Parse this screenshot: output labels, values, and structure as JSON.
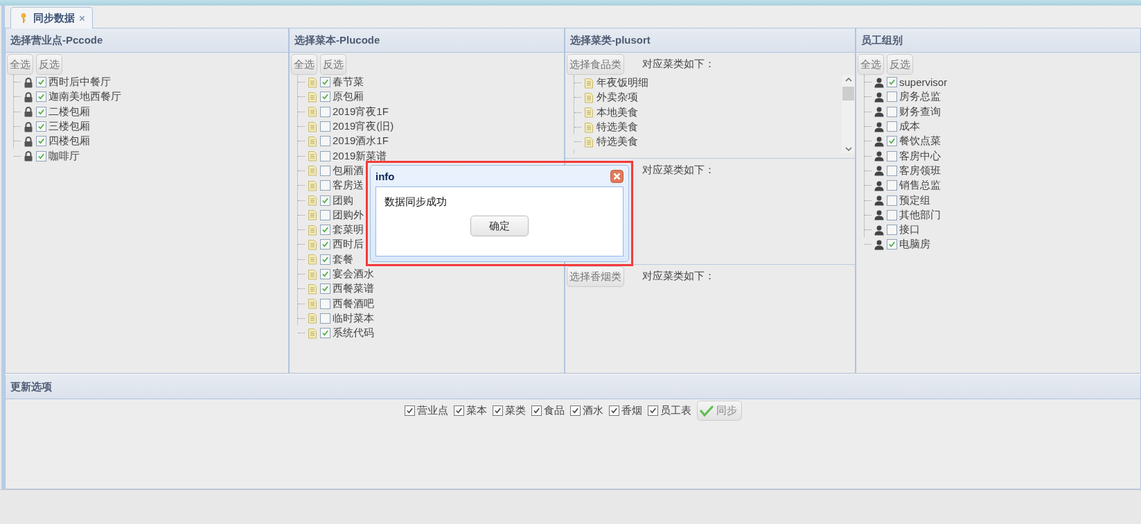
{
  "tab": {
    "label": "同步数据",
    "selected": true
  },
  "panels": [
    {
      "kind": "outlets",
      "title": "选择营业点-Pccode",
      "buttons": [
        "全选",
        "反选"
      ],
      "items": [
        {
          "label": "西时后中餐厅",
          "checked": true
        },
        {
          "label": "迦南美地西餐厅",
          "checked": true
        },
        {
          "label": "二楼包厢",
          "checked": true
        },
        {
          "label": "三楼包厢",
          "checked": true
        },
        {
          "label": "四楼包厢",
          "checked": true
        },
        {
          "label": "咖啡厅",
          "checked": true
        }
      ]
    },
    {
      "kind": "menus",
      "title": "选择菜本-Plucode",
      "buttons": [
        "全选",
        "反选"
      ],
      "items": [
        {
          "label": "春节菜",
          "checked": true
        },
        {
          "label": "原包厢",
          "checked": true
        },
        {
          "label": "2019宵夜1F",
          "checked": false
        },
        {
          "label": "2019宵夜(旧)",
          "checked": false
        },
        {
          "label": "2019酒水1F",
          "checked": false
        },
        {
          "label": "2019新菜谱",
          "checked": false
        },
        {
          "label": "包厢酒",
          "checked": false
        },
        {
          "label": "客房送",
          "checked": false
        },
        {
          "label": "团购",
          "checked": true
        },
        {
          "label": "团购外",
          "checked": false
        },
        {
          "label": "套菜明",
          "checked": true
        },
        {
          "label": "西时后",
          "checked": true
        },
        {
          "label": "套餐",
          "checked": true
        },
        {
          "label": "宴会酒水",
          "checked": true
        },
        {
          "label": "西餐菜谱",
          "checked": true
        },
        {
          "label": "西餐酒吧",
          "checked": false
        },
        {
          "label": "临时菜本",
          "checked": false
        },
        {
          "label": "系统代码",
          "checked": true
        }
      ]
    },
    {
      "kind": "categories",
      "title": "选择菜类-plusort",
      "sections": [
        {
          "button": "选择食品类",
          "caption": "对应菜类如下：",
          "scroll": true,
          "items": [
            "年夜饭明细",
            "外卖杂项",
            "本地美食",
            "特选美食",
            "特选美食"
          ]
        },
        {
          "caption": "对应菜类如下：",
          "scroll": false
        },
        {
          "button": "选择香烟类",
          "caption": "对应菜类如下：",
          "scroll": false
        }
      ]
    },
    {
      "kind": "staff",
      "title": "员工组别",
      "buttons": [
        "全选",
        "反选"
      ],
      "items": [
        {
          "label": "supervisor",
          "checked": true
        },
        {
          "label": "房务总监",
          "checked": false
        },
        {
          "label": "财务查询",
          "checked": false
        },
        {
          "label": "成本",
          "checked": false
        },
        {
          "label": "餐饮点菜",
          "checked": true
        },
        {
          "label": "客房中心",
          "checked": false
        },
        {
          "label": "客房领班",
          "checked": false
        },
        {
          "label": "销售总监",
          "checked": false
        },
        {
          "label": "预定组",
          "checked": false
        },
        {
          "label": "其他部门",
          "checked": false
        },
        {
          "label": "接口",
          "checked": false
        },
        {
          "label": "电脑房",
          "checked": true
        }
      ]
    }
  ],
  "options": {
    "title": "更新选项",
    "items": [
      {
        "label": "营业点",
        "checked": true
      },
      {
        "label": "菜本",
        "checked": true
      },
      {
        "label": "菜类",
        "checked": true
      },
      {
        "label": "食品",
        "checked": true
      },
      {
        "label": "酒水",
        "checked": true
      },
      {
        "label": "香烟",
        "checked": true
      },
      {
        "label": "员工表",
        "checked": true
      }
    ],
    "sync_button": "同步"
  },
  "dialog": {
    "title": "info",
    "message": "数据同步成功",
    "button": "确定",
    "highlighted": true
  }
}
